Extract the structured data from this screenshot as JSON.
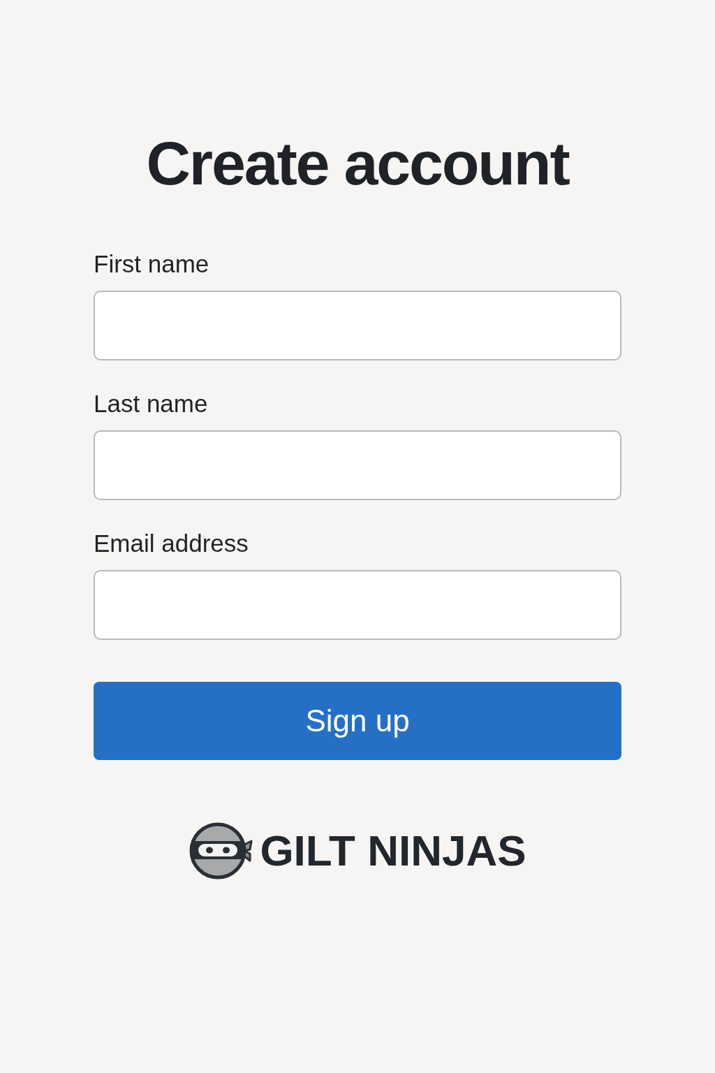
{
  "title": "Create account",
  "fields": [
    {
      "label": "First name"
    },
    {
      "label": "Last name"
    },
    {
      "label": "Email address"
    }
  ],
  "submit_button": {
    "label": "Sign up"
  },
  "brand": {
    "name": "GILT NINJAS"
  }
}
